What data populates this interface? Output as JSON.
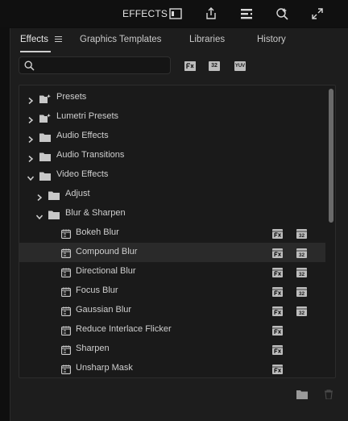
{
  "header": {
    "title": "EFFECTS"
  },
  "tabs": [
    {
      "label": "Effects"
    },
    {
      "label": "Graphics Templates"
    },
    {
      "label": "Libraries"
    },
    {
      "label": "History"
    }
  ],
  "search": {
    "value": "",
    "placeholder": ""
  },
  "filters": [
    {
      "name": "accelerated-effects-filter",
      "text": ""
    },
    {
      "name": "32bit-filter",
      "text": "32"
    },
    {
      "name": "yuv-filter",
      "text": "YUV"
    }
  ],
  "tree": [
    {
      "label": "Presets",
      "type": "preset-folder",
      "expanded": false,
      "level": 0
    },
    {
      "label": "Lumetri Presets",
      "type": "preset-folder",
      "expanded": false,
      "level": 0
    },
    {
      "label": "Audio Effects",
      "type": "folder",
      "expanded": false,
      "level": 0
    },
    {
      "label": "Audio Transitions",
      "type": "folder",
      "expanded": false,
      "level": 0
    },
    {
      "label": "Video Effects",
      "type": "folder",
      "expanded": true,
      "level": 0
    },
    {
      "label": "Adjust",
      "type": "folder",
      "expanded": false,
      "level": 1
    },
    {
      "label": "Blur & Sharpen",
      "type": "folder",
      "expanded": true,
      "level": 1
    },
    {
      "label": "Bokeh Blur",
      "type": "effect",
      "level": 2,
      "accelerated": true,
      "bit32": "32"
    },
    {
      "label": "Compound Blur",
      "type": "effect",
      "level": 2,
      "accelerated": true,
      "bit32": "32",
      "selected": true
    },
    {
      "label": "Directional Blur",
      "type": "effect",
      "level": 2,
      "accelerated": true,
      "bit32": "32"
    },
    {
      "label": "Focus Blur",
      "type": "effect",
      "level": 2,
      "accelerated": true,
      "bit32": "32"
    },
    {
      "label": "Gaussian Blur",
      "type": "effect",
      "level": 2,
      "accelerated": true,
      "bit32": "32"
    },
    {
      "label": "Reduce Interlace Flicker",
      "type": "effect",
      "level": 2,
      "accelerated": true,
      "bit32": ""
    },
    {
      "label": "Sharpen",
      "type": "effect",
      "level": 2,
      "accelerated": true,
      "bit32": ""
    },
    {
      "label": "Unsharp Mask",
      "type": "effect",
      "level": 2,
      "accelerated": true,
      "bit32": ""
    }
  ],
  "colors": {
    "panel": "#1d1d1d",
    "selected_row": "#2a2a2a",
    "text": "#cfcfcf"
  }
}
